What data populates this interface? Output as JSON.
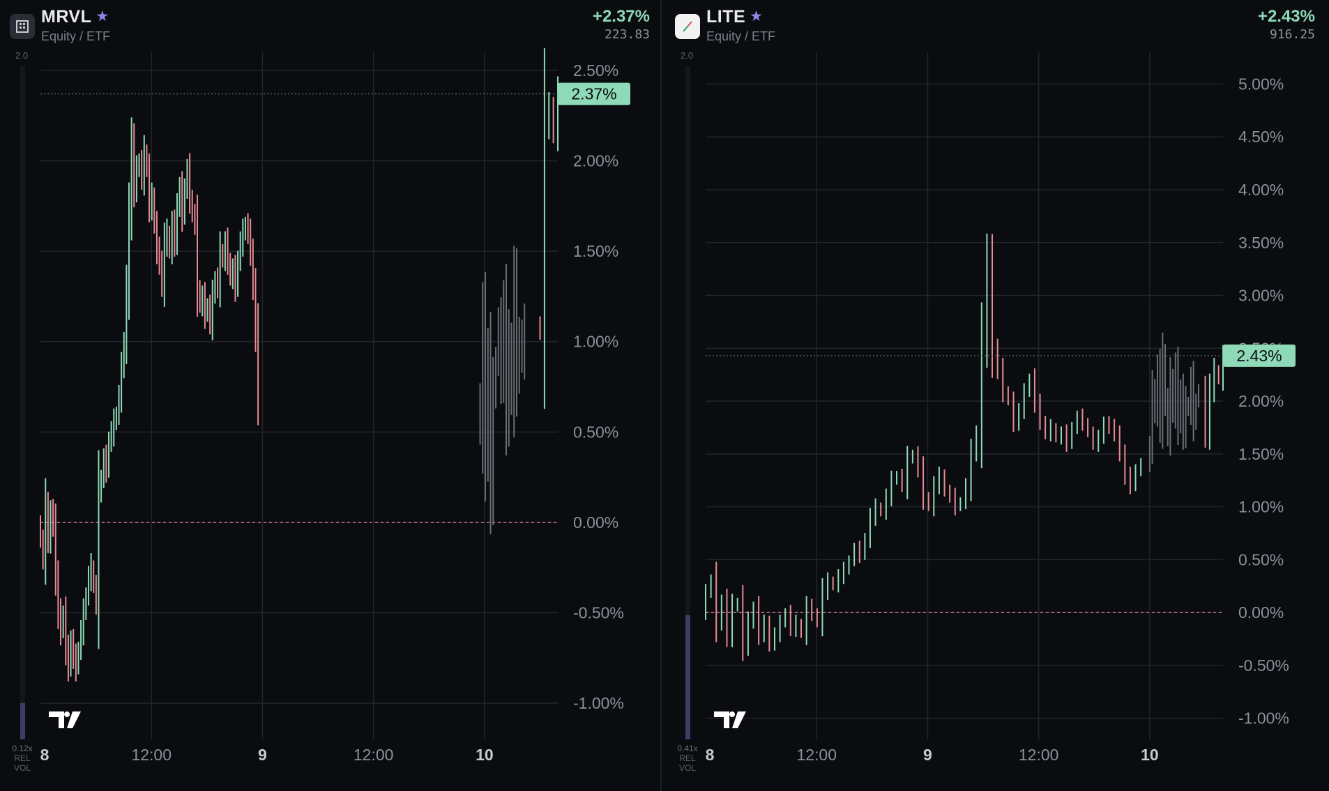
{
  "colors": {
    "up": "#8ed9b7",
    "down": "#e88a93",
    "ghost": "#6b6e75",
    "grid": "#22252b",
    "zero": "#d97a89",
    "volume": "#3f3d66",
    "badge": "#8ed9b7"
  },
  "panels": [
    {
      "symbol": "MRVL",
      "type_label": "Equity / ETF",
      "change": "+2.37%",
      "price": "223.83",
      "badge": "2.37%",
      "vol_scale_top": "2.0",
      "vol_multiplier": "0.12x",
      "rel_label": "REL",
      "vol_label": "VOL",
      "icon": "building-icon",
      "rel_volume": 0.12,
      "chart_data": {
        "type": "bar",
        "ylim": [
          -1.2,
          2.6
        ],
        "last": 2.37,
        "yticks": [
          "2.50%",
          "2.00%",
          "1.50%",
          "1.00%",
          "0.50%",
          "0.00%",
          "-0.50%",
          "-1.00%"
        ],
        "ytick_values": [
          2.5,
          2.0,
          1.5,
          1.0,
          0.5,
          0.0,
          -0.5,
          -1.0
        ],
        "xticks": [
          "8",
          "12:00",
          "9",
          "12:00",
          "10"
        ],
        "xtick_values": [
          0,
          0.5,
          1,
          1.5,
          2
        ],
        "xtick_bold": [
          true,
          false,
          true,
          false,
          true
        ],
        "xlim": [
          0,
          2.33
        ],
        "sessions": [
          {
            "start": 0.0,
            "end": 0.98,
            "ghost": false,
            "values": [
              -0.1,
              -0.2,
              0.1,
              -0.1,
              0.05,
              0,
              -0.3,
              -0.5,
              -0.6,
              -0.5,
              -0.7,
              -0.8,
              -0.65,
              -0.75,
              -0.8,
              -0.7,
              -0.6,
              -0.5,
              -0.4,
              -0.3,
              -0.25,
              -0.35,
              -0.45,
              0.15,
              0.25,
              0.35,
              0.3,
              0.45,
              0.5,
              0.55,
              0.6,
              0.7,
              0.85,
              1.0,
              1.3,
              1.7,
              2.1,
              1.85,
              1.95,
              2.0,
              1.9,
              2.05,
              1.95,
              1.75,
              1.8,
              1.65,
              1.5,
              1.45,
              1.3,
              1.55,
              1.6,
              1.5,
              1.65,
              1.55,
              1.75,
              1.85,
              1.7,
              1.85,
              1.95,
              1.8,
              1.7,
              1.65,
              1.3,
              1.2,
              1.25,
              1.15,
              1.2,
              1.1,
              1.25,
              1.35,
              1.3,
              1.5,
              1.45,
              1.55,
              1.45,
              1.35,
              1.4,
              1.3,
              1.45,
              1.55,
              1.6,
              1.65,
              1.6,
              1.5,
              1.3,
              1.05,
              0.7
            ]
          },
          {
            "start": 1.98,
            "end": 2.18,
            "ghost": true,
            "values": [
              0.5,
              1.1,
              0.4,
              0.9,
              0.2,
              0.7,
              0.9,
              1.1,
              0.8,
              1.2,
              0.6,
              1.0,
              0.7,
              1.3,
              0.8,
              1.05,
              0.9,
              1.1
            ]
          },
          {
            "start": 2.25,
            "end": 2.33,
            "ghost": false,
            "values": [
              1.05,
              2.2,
              2.3,
              2.15,
              2.37
            ]
          }
        ]
      }
    },
    {
      "symbol": "LITE",
      "type_label": "Equity / ETF",
      "change": "+2.43%",
      "price": "916.25",
      "badge": "2.43%",
      "vol_scale_top": "2.0",
      "vol_multiplier": "0.41x",
      "rel_label": "REL",
      "vol_label": "VOL",
      "icon": "chart-line-icon",
      "rel_volume": 0.41,
      "chart_data": {
        "type": "bar",
        "ylim": [
          -1.2,
          5.3
        ],
        "last": 2.43,
        "yticks": [
          "5.00%",
          "4.50%",
          "4.00%",
          "3.50%",
          "3.00%",
          "2.50%",
          "2.00%",
          "1.50%",
          "1.00%",
          "0.50%",
          "0.00%",
          "-0.50%",
          "-1.00%"
        ],
        "ytick_values": [
          5.0,
          4.5,
          4.0,
          3.5,
          3.0,
          2.5,
          2.0,
          1.5,
          1.0,
          0.5,
          0.0,
          -0.5,
          -1.0
        ],
        "xticks": [
          "8",
          "12:00",
          "9",
          "12:00",
          "10"
        ],
        "xtick_values": [
          0,
          0.5,
          1,
          1.5,
          2
        ],
        "xtick_bold": [
          true,
          false,
          true,
          false,
          true
        ],
        "xlim": [
          0,
          2.33
        ],
        "sessions": [
          {
            "start": 0.0,
            "end": 1.96,
            "ghost": false,
            "values": [
              0.2,
              0.3,
              -0.1,
              0.1,
              -0.2,
              0.05,
              0.1,
              -0.3,
              -0.1,
              0.05,
              -0.2,
              -0.1,
              -0.3,
              -0.2,
              -0.1,
              0.0,
              -0.15,
              -0.1,
              -0.2,
              0.05,
              0.0,
              -0.1,
              0.2,
              0.3,
              0.25,
              0.35,
              0.4,
              0.5,
              0.6,
              0.55,
              0.7,
              0.9,
              1.0,
              0.95,
              1.1,
              1.25,
              1.3,
              1.2,
              1.45,
              1.5,
              1.35,
              1.1,
              1.0,
              1.2,
              1.3,
              1.15,
              1.1,
              1.0,
              1.05,
              1.2,
              1.5,
              1.7,
              2.6,
              3.3,
              2.5,
              2.3,
              2.1,
              2.0,
              1.8,
              1.9,
              2.1,
              2.2,
              2.0,
              1.8,
              1.7,
              1.75,
              1.65,
              1.7,
              1.6,
              1.75,
              1.85,
              1.8,
              1.7,
              1.6,
              1.65,
              1.8,
              1.75,
              1.7,
              1.5,
              1.3,
              1.2,
              1.35,
              1.4
            ]
          },
          {
            "start": 2.0,
            "end": 2.22,
            "ghost": true,
            "values": [
              1.6,
              2.1,
              1.9,
              2.3,
              1.8,
              2.4,
              2.0,
              1.7,
              2.2,
              1.9,
              2.3,
              1.8,
              2.1,
              1.7,
              2.0,
              1.9,
              2.2,
              1.8,
              2.0,
              2.1
            ]
          },
          {
            "start": 2.25,
            "end": 2.33,
            "ghost": false,
            "values": [
              1.7,
              2.1,
              2.3,
              2.2,
              2.43
            ]
          }
        ]
      }
    }
  ]
}
